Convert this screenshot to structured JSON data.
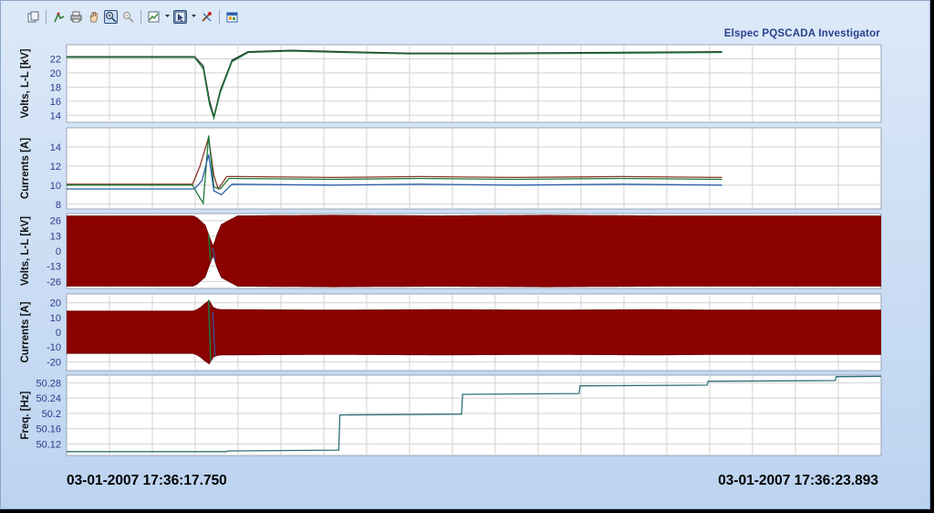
{
  "app_title": "Elspec PQSCADA Investigator",
  "toolbar": {
    "items": [
      {
        "name": "copy-icon"
      },
      {
        "name": "data-cursor-icon"
      },
      {
        "name": "print-icon"
      },
      {
        "name": "pan-hand-icon"
      },
      {
        "name": "zoom-in-icon",
        "active": true
      },
      {
        "name": "zoom-out-icon"
      },
      {
        "name": "chart-type-icon",
        "dropdown": true
      },
      {
        "name": "cursor-mode-icon",
        "active": true,
        "dropdown": true
      },
      {
        "name": "properties-icon"
      },
      {
        "name": "window-icon"
      }
    ]
  },
  "time_start": "03-01-2007 17:36:17.750",
  "time_end": "03-01-2007 17:36:23.893",
  "colors": {
    "phase_red": "#8b0000",
    "phase_green": "#1e7a3a",
    "phase_blue": "#2a5fa8",
    "rms_dark": "#4a4a4a",
    "freq": "#2f6f78",
    "axis_text": "#2a3a8c",
    "grid": "#d2d2d2"
  },
  "chart_data": [
    {
      "type": "line",
      "ylabel": "Volts, L-L [kV]",
      "ylim": [
        13,
        24
      ],
      "yticks": [
        14,
        16,
        18,
        20,
        22
      ],
      "series": [
        {
          "color": "#2a2a2a",
          "points": [
            [
              0,
              22.3
            ],
            [
              1.2,
              22.3
            ],
            [
              1.28,
              21.0
            ],
            [
              1.34,
              16.0
            ],
            [
              1.38,
              13.8
            ],
            [
              1.44,
              17.5
            ],
            [
              1.55,
              21.8
            ],
            [
              1.7,
              23.0
            ],
            [
              2.1,
              23.2
            ],
            [
              2.6,
              23.0
            ],
            [
              3.2,
              22.8
            ],
            [
              4.0,
              22.8
            ],
            [
              5.0,
              22.9
            ],
            [
              6.14,
              23.0
            ]
          ]
        },
        {
          "color": "#1e7a3a",
          "points": [
            [
              0,
              22.2
            ],
            [
              1.2,
              22.2
            ],
            [
              1.28,
              20.6
            ],
            [
              1.34,
              15.5
            ],
            [
              1.38,
              13.6
            ],
            [
              1.44,
              17.2
            ],
            [
              1.55,
              21.6
            ],
            [
              1.7,
              22.9
            ],
            [
              2.1,
              23.1
            ],
            [
              2.6,
              22.9
            ],
            [
              3.2,
              22.7
            ],
            [
              4.0,
              22.7
            ],
            [
              5.0,
              22.8
            ],
            [
              6.14,
              22.9
            ]
          ]
        }
      ]
    },
    {
      "type": "line",
      "ylabel": "Currents [A]",
      "ylim": [
        7.5,
        16
      ],
      "yticks": [
        8,
        10,
        12,
        14
      ],
      "series": [
        {
          "color": "#8b3a2a",
          "points": [
            [
              0,
              10.1
            ],
            [
              1.18,
              10.1
            ],
            [
              1.25,
              12.0
            ],
            [
              1.33,
              15.0
            ],
            [
              1.38,
              11.0
            ],
            [
              1.42,
              9.6
            ],
            [
              1.5,
              10.9
            ],
            [
              1.6,
              10.9
            ],
            [
              2.5,
              10.8
            ],
            [
              3.3,
              10.9
            ],
            [
              4.2,
              10.8
            ],
            [
              5.2,
              10.9
            ],
            [
              6.14,
              10.8
            ]
          ]
        },
        {
          "color": "#1e7a3a",
          "points": [
            [
              0,
              10.0
            ],
            [
              1.18,
              10.0
            ],
            [
              1.23,
              9.0
            ],
            [
              1.28,
              8.1
            ],
            [
              1.33,
              15.2
            ],
            [
              1.38,
              9.8
            ],
            [
              1.44,
              9.6
            ],
            [
              1.52,
              10.7
            ],
            [
              2.5,
              10.6
            ],
            [
              3.3,
              10.7
            ],
            [
              4.2,
              10.6
            ],
            [
              5.2,
              10.7
            ],
            [
              6.14,
              10.6
            ]
          ]
        },
        {
          "color": "#2a5fa8",
          "points": [
            [
              0,
              9.6
            ],
            [
              1.2,
              9.6
            ],
            [
              1.27,
              10.5
            ],
            [
              1.33,
              13.2
            ],
            [
              1.38,
              9.4
            ],
            [
              1.45,
              9.0
            ],
            [
              1.55,
              10.1
            ],
            [
              2.5,
              10.0
            ],
            [
              3.3,
              10.1
            ],
            [
              4.2,
              10.0
            ],
            [
              5.2,
              10.1
            ],
            [
              6.14,
              10.0
            ]
          ]
        }
      ]
    },
    {
      "type": "area",
      "ylabel": "Volts, L-L [kV]",
      "ylim": [
        -32,
        32
      ],
      "yticks": [
        26,
        13,
        0,
        -13,
        -26
      ],
      "envelope": [
        [
          0,
          30
        ],
        [
          1.2,
          30
        ],
        [
          1.3,
          22
        ],
        [
          1.37,
          3
        ],
        [
          1.44,
          22
        ],
        [
          1.6,
          30
        ],
        [
          2.5,
          30.5
        ],
        [
          3.5,
          30
        ],
        [
          4.5,
          30.5
        ],
        [
          5.5,
          30
        ],
        [
          6.14,
          30
        ]
      ]
    },
    {
      "type": "area",
      "ylabel": "Currents [A]",
      "ylim": [
        -26,
        26
      ],
      "yticks": [
        20,
        10,
        0,
        -10,
        -20
      ],
      "envelope": [
        [
          0,
          14.3
        ],
        [
          1.2,
          14.3
        ],
        [
          1.28,
          18
        ],
        [
          1.33,
          22
        ],
        [
          1.38,
          16
        ],
        [
          1.45,
          15.3
        ],
        [
          2.5,
          15
        ],
        [
          3.5,
          15.3
        ],
        [
          4.5,
          15
        ],
        [
          5.5,
          15.3
        ],
        [
          6.14,
          15
        ]
      ]
    },
    {
      "type": "line",
      "ylabel": "Freq. [Hz]",
      "ylim": [
        50.09,
        50.3
      ],
      "yticks": [
        50.12,
        50.16,
        50.2,
        50.24,
        50.28
      ],
      "series": [
        {
          "color": "#2f6f78",
          "points": [
            [
              0,
              50.1
            ],
            [
              1.5,
              50.1
            ],
            [
              1.51,
              50.102
            ],
            [
              2.55,
              50.104
            ],
            [
              2.56,
              50.196
            ],
            [
              3.7,
              50.198
            ],
            [
              3.71,
              50.25
            ],
            [
              4.8,
              50.252
            ],
            [
              4.81,
              50.272
            ],
            [
              6.0,
              50.274
            ],
            [
              6.01,
              50.284
            ],
            [
              7.2,
              50.286
            ],
            [
              7.21,
              50.296
            ],
            [
              7.63,
              50.297
            ]
          ]
        }
      ]
    }
  ]
}
